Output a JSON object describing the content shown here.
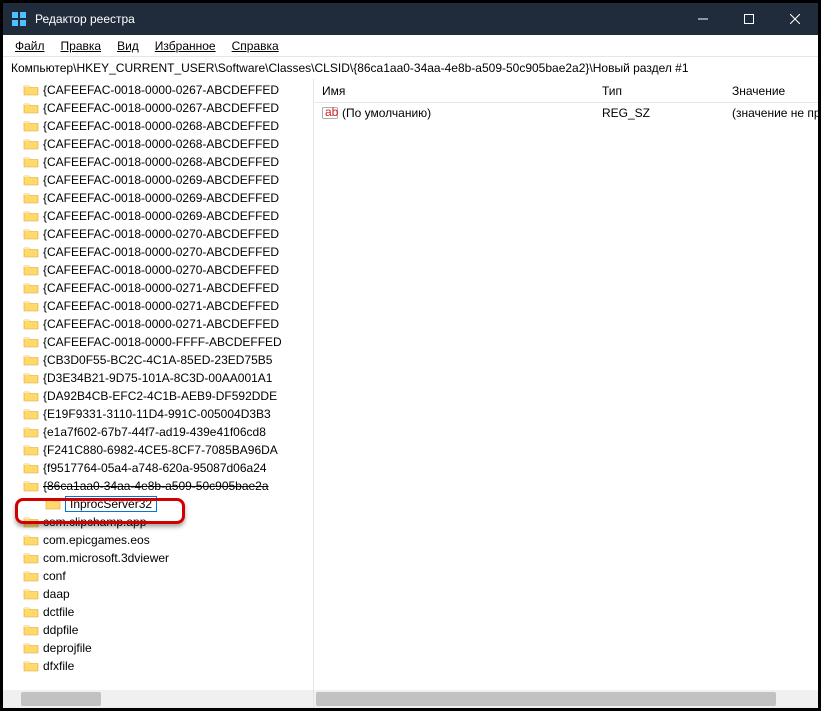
{
  "titlebar": {
    "title": "Редактор реестра"
  },
  "menu": {
    "file": "Файл",
    "edit": "Правка",
    "view": "Вид",
    "favorites": "Избранное",
    "help": "Справка"
  },
  "path": "Компьютер\\HKEY_CURRENT_USER\\Software\\Classes\\CLSID\\{86ca1aa0-34aa-4e8b-a509-50c905bae2a2}\\Новый раздел #1",
  "tree": {
    "items": [
      "{CAFEEFAC-0018-0000-0267-ABCDEFFED",
      "{CAFEEFAC-0018-0000-0267-ABCDEFFED",
      "{CAFEEFAC-0018-0000-0268-ABCDEFFED",
      "{CAFEEFAC-0018-0000-0268-ABCDEFFED",
      "{CAFEEFAC-0018-0000-0268-ABCDEFFED",
      "{CAFEEFAC-0018-0000-0269-ABCDEFFED",
      "{CAFEEFAC-0018-0000-0269-ABCDEFFED",
      "{CAFEEFAC-0018-0000-0269-ABCDEFFED",
      "{CAFEEFAC-0018-0000-0270-ABCDEFFED",
      "{CAFEEFAC-0018-0000-0270-ABCDEFFED",
      "{CAFEEFAC-0018-0000-0270-ABCDEFFED",
      "{CAFEEFAC-0018-0000-0271-ABCDEFFED",
      "{CAFEEFAC-0018-0000-0271-ABCDEFFED",
      "{CAFEEFAC-0018-0000-0271-ABCDEFFED",
      "{CAFEEFAC-0018-0000-FFFF-ABCDEFFED",
      "{CB3D0F55-BC2C-4C1A-85ED-23ED75B5",
      "{D3E34B21-9D75-101A-8C3D-00AA001A1",
      "{DA92B4CB-EFC2-4C1B-AEB9-DF592DDE",
      "{E19F9331-3110-11D4-991C-005004D3B3",
      "{e1a7f602-67b7-44f7-ad19-439e41f06cd8",
      "{F241C880-6982-4CE5-8CF7-7085BA96DA",
      "{f9517764-05a4-a748-620a-95087d06a24",
      "{86ca1aa0-34aa-4e8b-a509-50c905bae2a"
    ],
    "edit_item": "InprocServer32",
    "tail": [
      "com.clipchamp.app",
      "com.epicgames.eos",
      "com.microsoft.3dviewer",
      "conf",
      "daap",
      "dctfile",
      "ddpfile",
      "deprojfile",
      "dfxfile"
    ]
  },
  "values_header": {
    "name": "Имя",
    "type": "Тип",
    "value": "Значение"
  },
  "values": [
    {
      "name": "(По умолчанию)",
      "type": "REG_SZ",
      "value": "(значение не присво"
    }
  ]
}
